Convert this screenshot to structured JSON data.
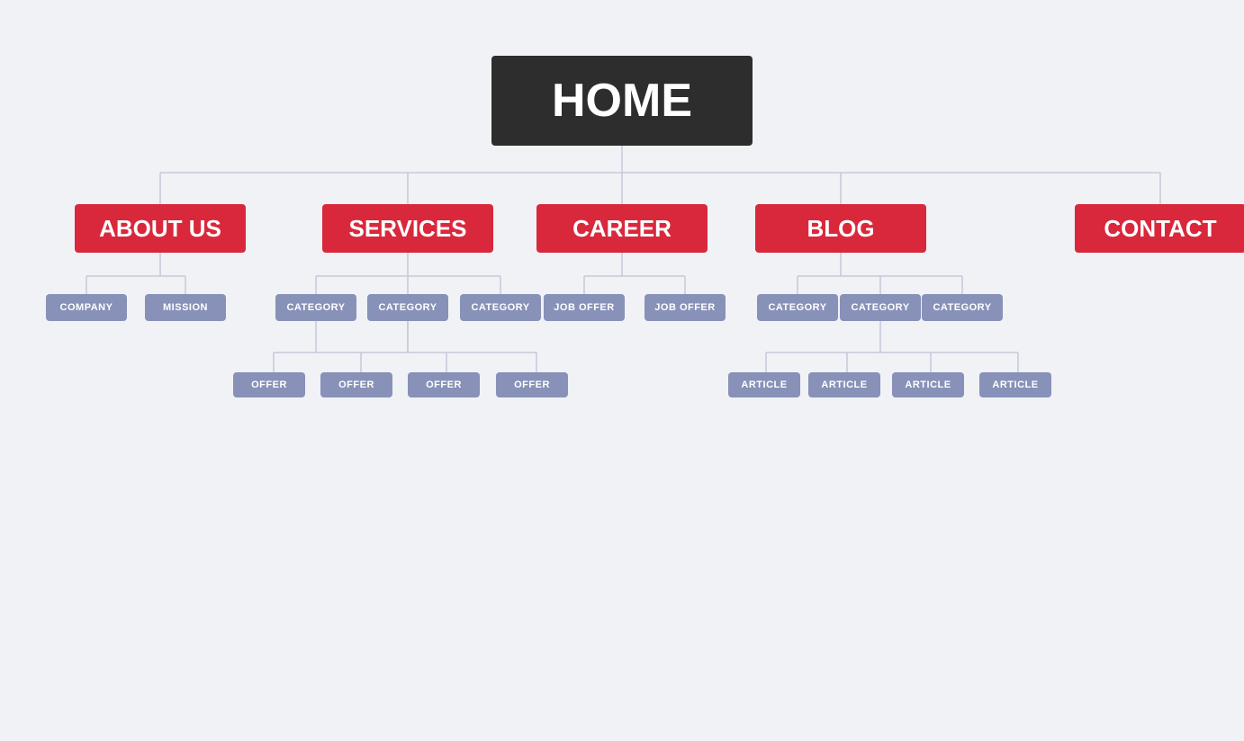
{
  "home": {
    "label": "HOME"
  },
  "level1": [
    {
      "id": "about",
      "label": "ABOUT US"
    },
    {
      "id": "services",
      "label": "SERVICES"
    },
    {
      "id": "career",
      "label": "CAREER"
    },
    {
      "id": "blog",
      "label": "BLOG"
    },
    {
      "id": "contact",
      "label": "CONTACT"
    }
  ],
  "about_children": [
    "COMPANY",
    "MISSION"
  ],
  "services_children": [
    "CATEGORY",
    "CATEGORY",
    "CATEGORY"
  ],
  "services_grandchildren": [
    "OFFER",
    "OFFER",
    "OFFER",
    "OFFER"
  ],
  "career_children": [
    "JOB OFFER",
    "JOB OFFER"
  ],
  "blog_children": [
    "CATEGORY",
    "CATEGORY",
    "CATEGORY"
  ],
  "blog_grandchildren": [
    "ARTICLE",
    "ARTICLE",
    "ARTICLE",
    "ARTICLE"
  ]
}
